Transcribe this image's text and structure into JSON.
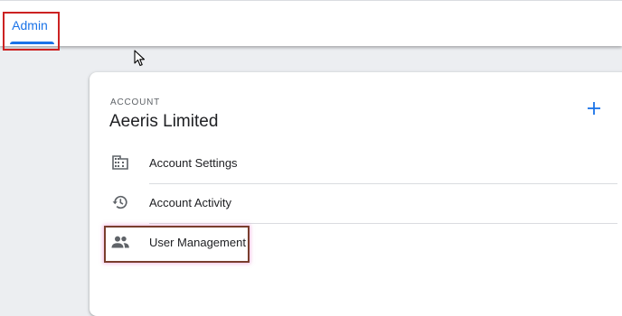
{
  "tabs": {
    "admin_label": "Admin"
  },
  "account": {
    "section_label": "ACCOUNT",
    "name": "Aeeris Limited",
    "add_label": "+",
    "menu": [
      {
        "label": "Account Settings",
        "icon": "building-icon"
      },
      {
        "label": "Account Activity",
        "icon": "history-icon"
      },
      {
        "label": "User Management",
        "icon": "people-icon"
      }
    ]
  },
  "colors": {
    "accent": "#1a73e8",
    "annotation_red": "#cc2222",
    "annotation_brown": "#7a3e2e"
  }
}
